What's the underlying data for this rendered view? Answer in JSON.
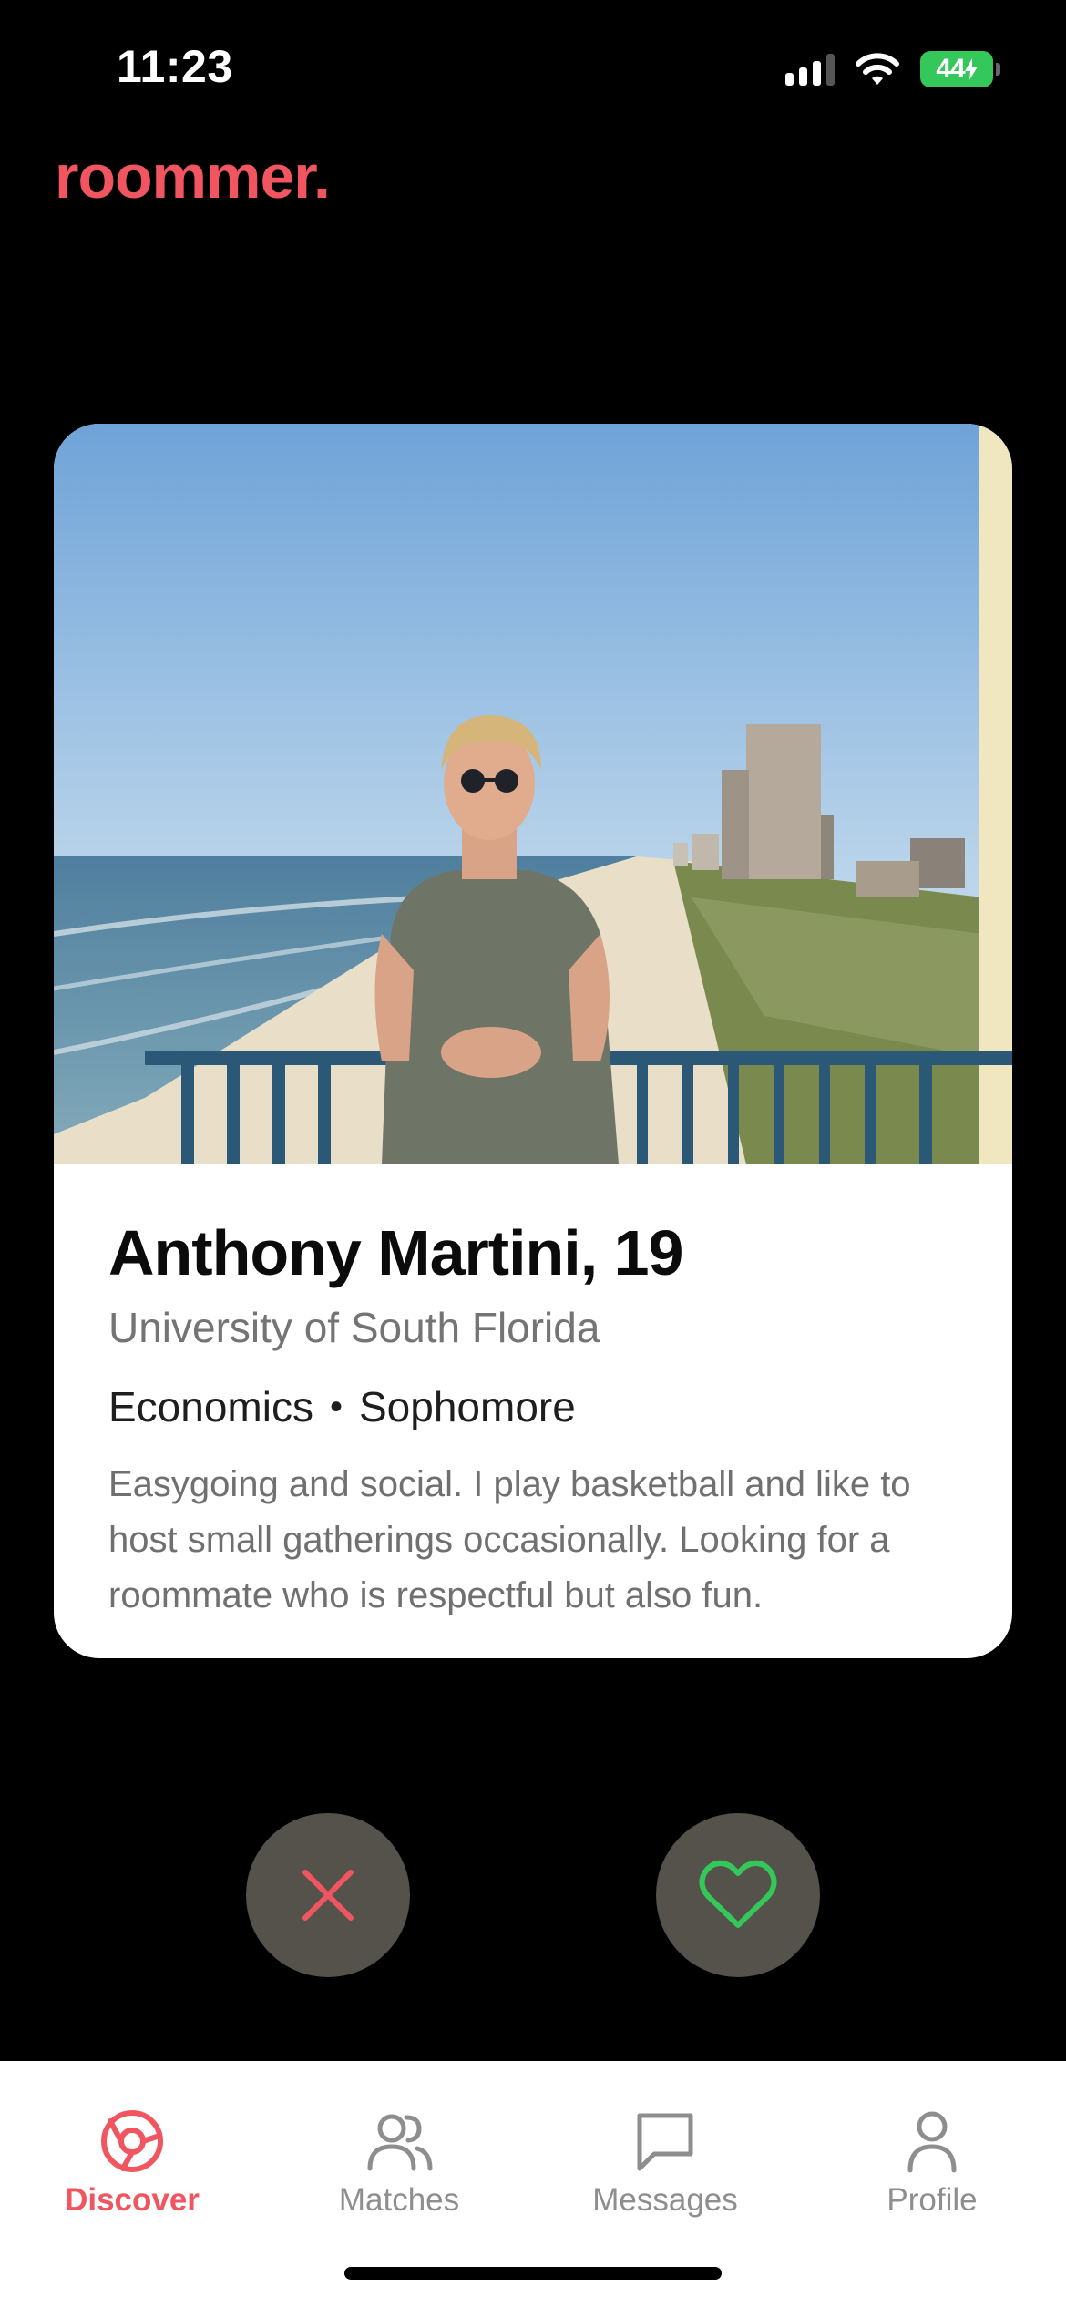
{
  "status_bar": {
    "time": "11:23",
    "battery": "44",
    "icons": [
      "signal-icon",
      "wifi-icon",
      "battery-charging-icon"
    ]
  },
  "app": {
    "brand": "roommer."
  },
  "profile_card": {
    "name_age": "Anthony Martini, 19",
    "school": "University of South Florida",
    "major": "Economics",
    "separator": "•",
    "year": "Sophomore",
    "bio": "Easygoing and social. I play basketball and like to host small gatherings occasionally. Looking for a roommate who is respectful but also fun.",
    "photo": "profile-photo-beach-balcony"
  },
  "actions": {
    "pass_icon": "close-icon",
    "like_icon": "heart-icon"
  },
  "tab_bar": {
    "items": [
      {
        "label": "Discover",
        "icon": "discover-icon",
        "active": true
      },
      {
        "label": "Matches",
        "icon": "matches-icon",
        "active": false
      },
      {
        "label": "Messages",
        "icon": "messages-icon",
        "active": false
      },
      {
        "label": "Profile",
        "icon": "profile-icon",
        "active": false
      }
    ]
  },
  "colors": {
    "brand": "#f05560",
    "background": "#000000",
    "card": "#ffffff",
    "action_button": "#54524a",
    "like_green": "#34c759",
    "inactive_tab": "#8e8e8e"
  }
}
